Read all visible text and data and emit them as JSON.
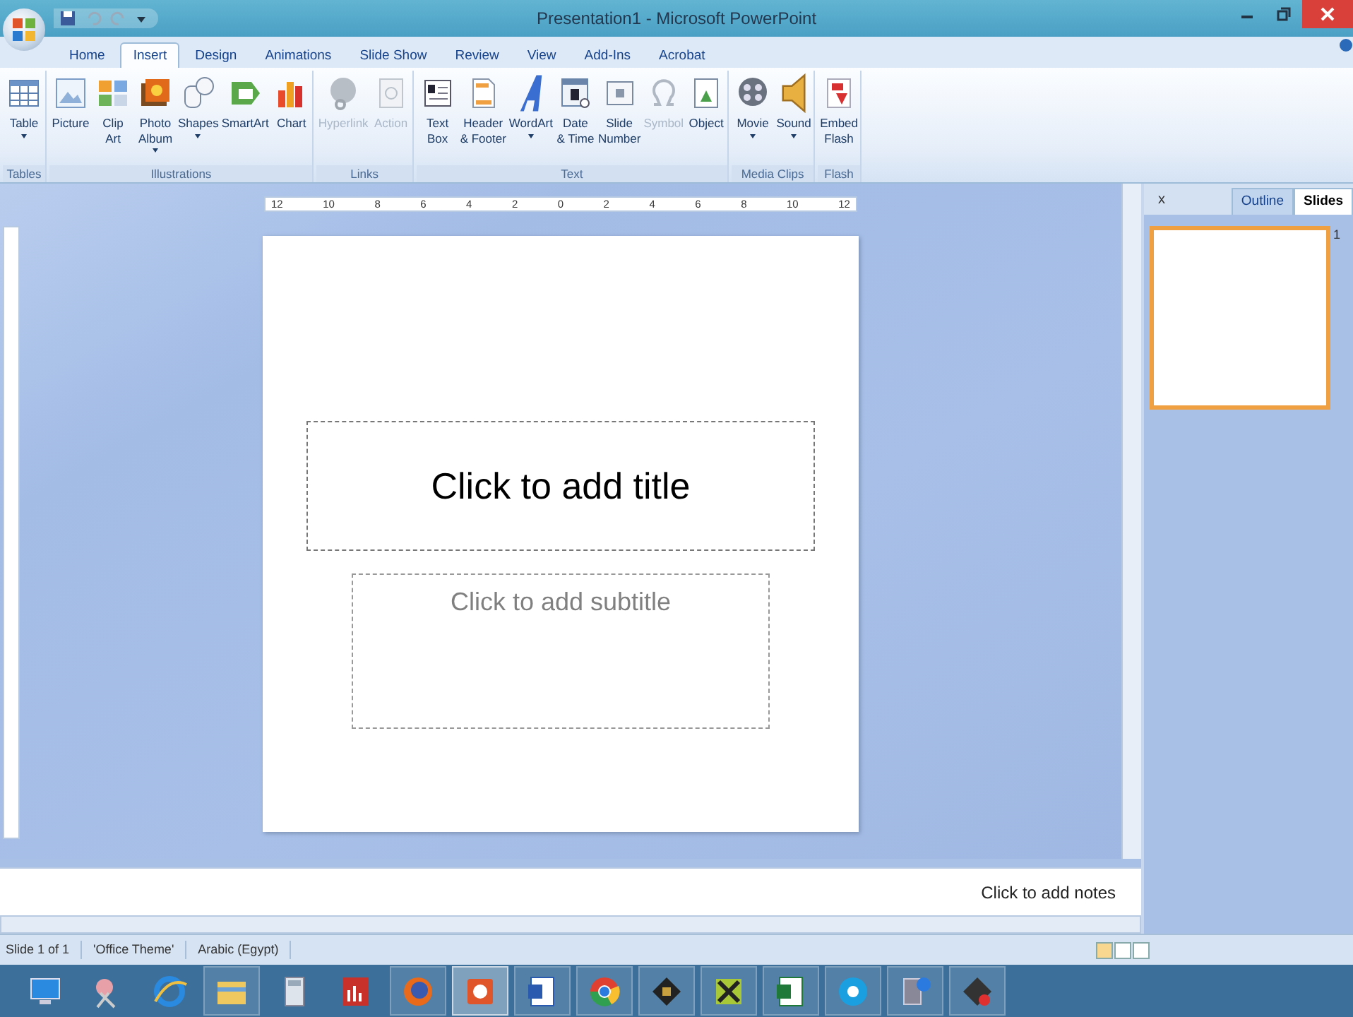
{
  "window": {
    "title": "Presentation1 - Microsoft PowerPoint"
  },
  "tabs": [
    {
      "label": "Home",
      "selected": false
    },
    {
      "label": "Insert",
      "selected": true
    },
    {
      "label": "Design",
      "selected": false
    },
    {
      "label": "Animations",
      "selected": false
    },
    {
      "label": "Slide Show",
      "selected": false
    },
    {
      "label": "Review",
      "selected": false
    },
    {
      "label": "View",
      "selected": false
    },
    {
      "label": "Add-Ins",
      "selected": false
    },
    {
      "label": "Acrobat",
      "selected": false
    }
  ],
  "ribbon": [
    {
      "group": "Tables",
      "buttons": [
        {
          "label": "Table",
          "dropdown": true,
          "disabled": false
        }
      ]
    },
    {
      "group": "Illustrations",
      "buttons": [
        {
          "label": "Picture",
          "dropdown": false,
          "disabled": false
        },
        {
          "label": "Clip\nArt",
          "dropdown": false,
          "disabled": false
        },
        {
          "label": "Photo\nAlbum",
          "dropdown": true,
          "disabled": false
        },
        {
          "label": "Shapes",
          "dropdown": true,
          "disabled": false
        },
        {
          "label": "SmartArt",
          "dropdown": false,
          "disabled": false
        },
        {
          "label": "Chart",
          "dropdown": false,
          "disabled": false
        }
      ]
    },
    {
      "group": "Links",
      "buttons": [
        {
          "label": "Hyperlink",
          "dropdown": false,
          "disabled": true
        },
        {
          "label": "Action",
          "dropdown": false,
          "disabled": true
        }
      ]
    },
    {
      "group": "Text",
      "buttons": [
        {
          "label": "Text\nBox",
          "dropdown": false,
          "disabled": false
        },
        {
          "label": "Header\n& Footer",
          "dropdown": false,
          "disabled": false
        },
        {
          "label": "WordArt",
          "dropdown": true,
          "disabled": false
        },
        {
          "label": "Date\n& Time",
          "dropdown": false,
          "disabled": false
        },
        {
          "label": "Slide\nNumber",
          "dropdown": false,
          "disabled": false
        },
        {
          "label": "Symbol",
          "dropdown": false,
          "disabled": true
        },
        {
          "label": "Object",
          "dropdown": false,
          "disabled": false
        }
      ]
    },
    {
      "group": "Media Clips",
      "buttons": [
        {
          "label": "Movie",
          "dropdown": true,
          "disabled": false
        },
        {
          "label": "Sound",
          "dropdown": true,
          "disabled": false
        }
      ]
    },
    {
      "group": "Flash",
      "buttons": [
        {
          "label": "Embed\nFlash",
          "dropdown": false,
          "disabled": false
        }
      ]
    }
  ],
  "ruler": {
    "labels": [
      "12",
      "10",
      "8",
      "6",
      "4",
      "2",
      "0",
      "2",
      "4",
      "6",
      "8",
      "10",
      "12"
    ]
  },
  "slide": {
    "title_placeholder": "Click to add title",
    "subtitle_placeholder": "Click to add subtitle"
  },
  "slides_panel": {
    "close": "x",
    "tabs": [
      {
        "label": "Outline",
        "selected": false
      },
      {
        "label": "Slides",
        "selected": true
      }
    ],
    "slide_number": "1"
  },
  "notes": {
    "placeholder": "Click to add notes"
  },
  "status_bar": [
    "Slide 1 of 1",
    "'Office Theme'",
    "Arabic (Egypt)"
  ],
  "taskbar": [
    {
      "running": false,
      "selected": false
    },
    {
      "running": false,
      "selected": false
    },
    {
      "running": false,
      "selected": false
    },
    {
      "running": true,
      "selected": false
    },
    {
      "running": false,
      "selected": false
    },
    {
      "running": false,
      "selected": false
    },
    {
      "running": true,
      "selected": false
    },
    {
      "running": true,
      "selected": true
    },
    {
      "running": true,
      "selected": false
    },
    {
      "running": true,
      "selected": false
    },
    {
      "running": true,
      "selected": false
    },
    {
      "running": true,
      "selected": false
    },
    {
      "running": true,
      "selected": false
    },
    {
      "running": true,
      "selected": false
    },
    {
      "running": true,
      "selected": false
    },
    {
      "running": true,
      "selected": false
    }
  ]
}
